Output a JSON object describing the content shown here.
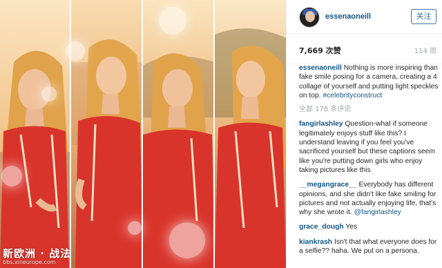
{
  "post": {
    "username": "essenaoneill",
    "follow_label": "关注",
    "likes": "7,669 次赞",
    "time_ago": "114 周",
    "caption": {
      "user": "essenaoneill",
      "text": "Nothing is more inspiring than fake smile posing for a camera, creating a 4 collage of yourself and putting light speckles on top.",
      "hashtag": "#celebrityconstruct"
    },
    "all_comments": "全部 178 条评论",
    "comments": [
      {
        "user": "fangirlashley",
        "text": "Question-what if someone legitimately enjoys stuff like this? I understand leaving if you feel you've sacrificed yourself but these captions seem like you're putting down girls who enjoy taking pictures like this"
      },
      {
        "user": "__megangrace__",
        "text": "Everybody has different opinions, and she didn't like fake smiling for pictures and not actually enjoying life, that's why she wrote it.",
        "mention": "@fangirlashley"
      },
      {
        "user": "grace_dough",
        "text": "Yes"
      },
      {
        "user": "kiankrash",
        "text": "Isn't that what everyone does for a selfie?? haha. We put on a persona."
      }
    ]
  },
  "watermark": {
    "main": "新欧洲 · 战法",
    "sub": "bbs.xineurope.com"
  },
  "colors": {
    "link": "#125688",
    "follow_border": "#3f729b",
    "dress": "#d9342b",
    "hair": "#e0a24a"
  }
}
